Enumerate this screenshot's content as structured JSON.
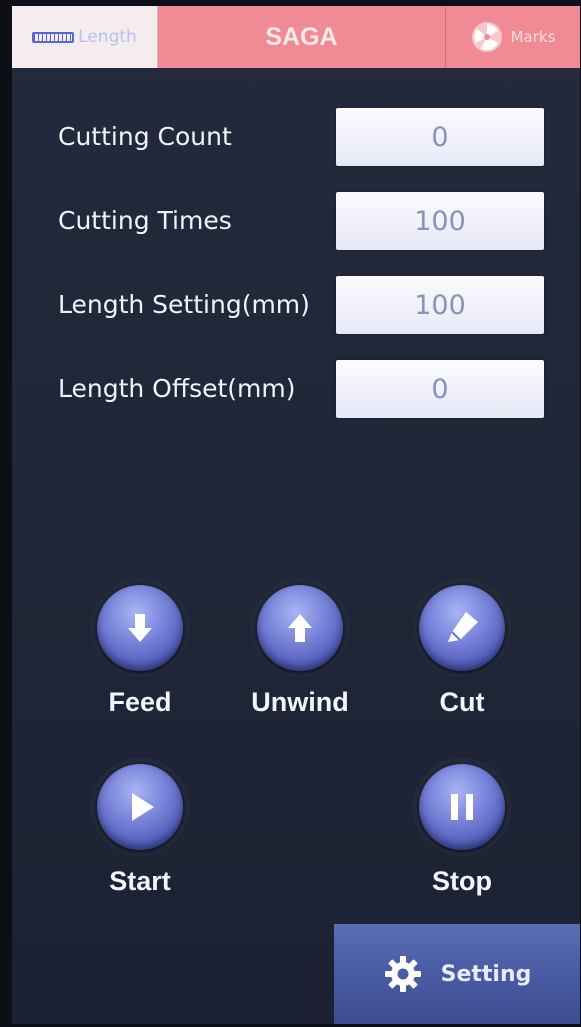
{
  "tabs": {
    "length_label": "Length",
    "title": "SAGA",
    "marks_label": "Marks"
  },
  "params": [
    {
      "label": "Cutting Count",
      "value": "0"
    },
    {
      "label": "Cutting Times",
      "value": "100"
    },
    {
      "label": "Length Setting(mm)",
      "value": "100"
    },
    {
      "label": "Length Offset(mm)",
      "value": "0"
    }
  ],
  "controls": {
    "feed": "Feed",
    "unwind": "Unwind",
    "cut": "Cut",
    "start": "Start",
    "stop": "Stop"
  },
  "setting": {
    "label": "Setting"
  },
  "icons": {
    "length_tab": "ruler-icon",
    "marks_tab": "marks-icon",
    "feed": "arrow-down-icon",
    "unwind": "arrow-up-icon",
    "cut": "knife-icon",
    "start": "play-icon",
    "stop": "pause-icon",
    "setting": "gear-icon"
  },
  "colors": {
    "background": "#1f2637",
    "title_bar": "#f08b95",
    "active_tab": "#f4ecef",
    "button_accent": "#6673d0",
    "setting_button": "#4a5ca4"
  }
}
